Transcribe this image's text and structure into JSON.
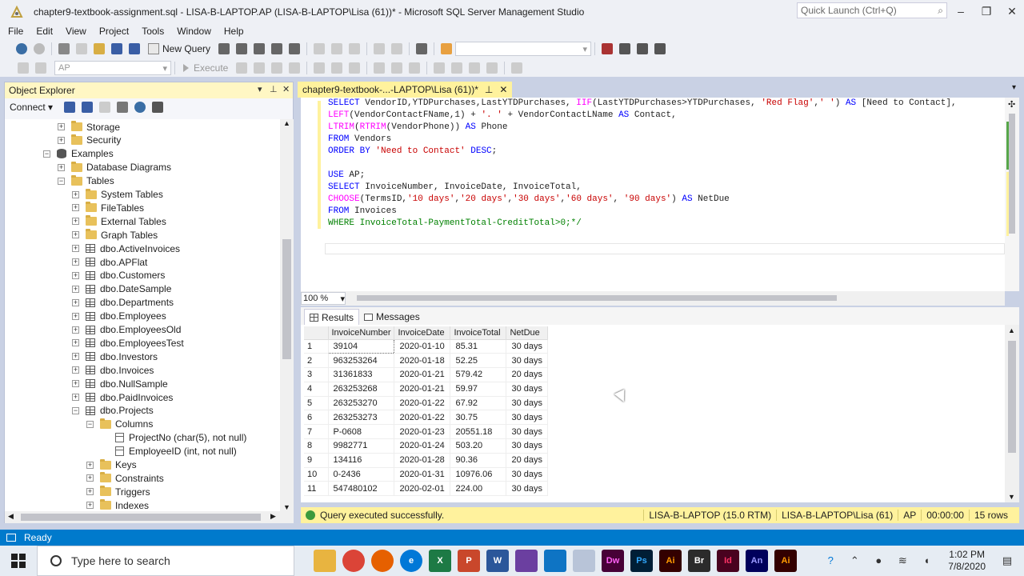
{
  "window": {
    "title": "chapter9-textbook-assignment.sql - LISA-B-LAPTOP.AP (LISA-B-LAPTOP\\Lisa (61))* - Microsoft SQL Server Management Studio",
    "quick_launch_placeholder": "Quick Launch (Ctrl+Q)"
  },
  "menu": [
    "File",
    "Edit",
    "View",
    "Project",
    "Tools",
    "Window",
    "Help"
  ],
  "toolbar": {
    "new_query_label": "New Query",
    "database_combo": "AP",
    "execute_label": "Execute"
  },
  "object_explorer": {
    "title": "Object Explorer",
    "connect_label": "Connect",
    "tree": [
      {
        "label": "Storage",
        "type": "folder",
        "exp": "+",
        "level": 3
      },
      {
        "label": "Security",
        "type": "folder",
        "exp": "+",
        "level": 3
      },
      {
        "label": "Examples",
        "type": "db",
        "exp": "−",
        "level": 2
      },
      {
        "label": "Database Diagrams",
        "type": "folder",
        "exp": "+",
        "level": 3
      },
      {
        "label": "Tables",
        "type": "folder",
        "exp": "−",
        "level": 3
      },
      {
        "label": "System Tables",
        "type": "folder",
        "exp": "+",
        "level": 4
      },
      {
        "label": "FileTables",
        "type": "folder",
        "exp": "+",
        "level": 4
      },
      {
        "label": "External Tables",
        "type": "folder",
        "exp": "+",
        "level": 4
      },
      {
        "label": "Graph Tables",
        "type": "folder",
        "exp": "+",
        "level": 4
      },
      {
        "label": "dbo.ActiveInvoices",
        "type": "table",
        "exp": "+",
        "level": 4
      },
      {
        "label": "dbo.APFlat",
        "type": "table",
        "exp": "+",
        "level": 4
      },
      {
        "label": "dbo.Customers",
        "type": "table",
        "exp": "+",
        "level": 4
      },
      {
        "label": "dbo.DateSample",
        "type": "table",
        "exp": "+",
        "level": 4
      },
      {
        "label": "dbo.Departments",
        "type": "table",
        "exp": "+",
        "level": 4
      },
      {
        "label": "dbo.Employees",
        "type": "table",
        "exp": "+",
        "level": 4
      },
      {
        "label": "dbo.EmployeesOld",
        "type": "table",
        "exp": "+",
        "level": 4
      },
      {
        "label": "dbo.EmployeesTest",
        "type": "table",
        "exp": "+",
        "level": 4
      },
      {
        "label": "dbo.Investors",
        "type": "table",
        "exp": "+",
        "level": 4
      },
      {
        "label": "dbo.Invoices",
        "type": "table",
        "exp": "+",
        "level": 4
      },
      {
        "label": "dbo.NullSample",
        "type": "table",
        "exp": "+",
        "level": 4
      },
      {
        "label": "dbo.PaidInvoices",
        "type": "table",
        "exp": "+",
        "level": 4
      },
      {
        "label": "dbo.Projects",
        "type": "table",
        "exp": "−",
        "level": 4
      },
      {
        "label": "Columns",
        "type": "folder",
        "exp": "−",
        "level": 5
      },
      {
        "label": "ProjectNo (char(5), not null)",
        "type": "column",
        "exp": "",
        "level": 6
      },
      {
        "label": "EmployeeID (int, not null)",
        "type": "column",
        "exp": "",
        "level": 6
      },
      {
        "label": "Keys",
        "type": "folder",
        "exp": "+",
        "level": 5
      },
      {
        "label": "Constraints",
        "type": "folder",
        "exp": "+",
        "level": 5
      },
      {
        "label": "Triggers",
        "type": "folder",
        "exp": "+",
        "level": 5
      },
      {
        "label": "Indexes",
        "type": "folder",
        "exp": "+",
        "level": 5
      }
    ]
  },
  "editor": {
    "tab_label": "chapter9-textbook-...-LAPTOP\\Lisa (61))*",
    "zoom": "100 %"
  },
  "results": {
    "tab_results": "Results",
    "tab_messages": "Messages",
    "columns": [
      "InvoiceNumber",
      "InvoiceDate",
      "InvoiceTotal",
      "NetDue"
    ],
    "rows": [
      [
        "1",
        "39104",
        "2020-01-10",
        "85.31",
        "30 days"
      ],
      [
        "2",
        "963253264",
        "2020-01-18",
        "52.25",
        "30 days"
      ],
      [
        "3",
        "31361833",
        "2020-01-21",
        "579.42",
        "20 days"
      ],
      [
        "4",
        "263253268",
        "2020-01-21",
        "59.97",
        "30 days"
      ],
      [
        "5",
        "263253270",
        "2020-01-22",
        "67.92",
        "30 days"
      ],
      [
        "6",
        "263253273",
        "2020-01-22",
        "30.75",
        "30 days"
      ],
      [
        "7",
        "P-0608",
        "2020-01-23",
        "20551.18",
        "30 days"
      ],
      [
        "8",
        "9982771",
        "2020-01-24",
        "503.20",
        "30 days"
      ],
      [
        "9",
        "134116",
        "2020-01-28",
        "90.36",
        "20 days"
      ],
      [
        "10",
        "0-2436",
        "2020-01-31",
        "10976.06",
        "30 days"
      ],
      [
        "11",
        "547480102",
        "2020-02-01",
        "224.00",
        "30 days"
      ]
    ]
  },
  "query_status": {
    "message": "Query executed successfully.",
    "server": "LISA-B-LAPTOP (15.0 RTM)",
    "login": "LISA-B-LAPTOP\\Lisa (61)",
    "database": "AP",
    "elapsed": "00:00:00",
    "rows": "15 rows"
  },
  "status_bar": {
    "text": "Ready"
  },
  "taskbar": {
    "search_placeholder": "Type here to search",
    "time": "1:02 PM",
    "date": "7/8/2020"
  }
}
